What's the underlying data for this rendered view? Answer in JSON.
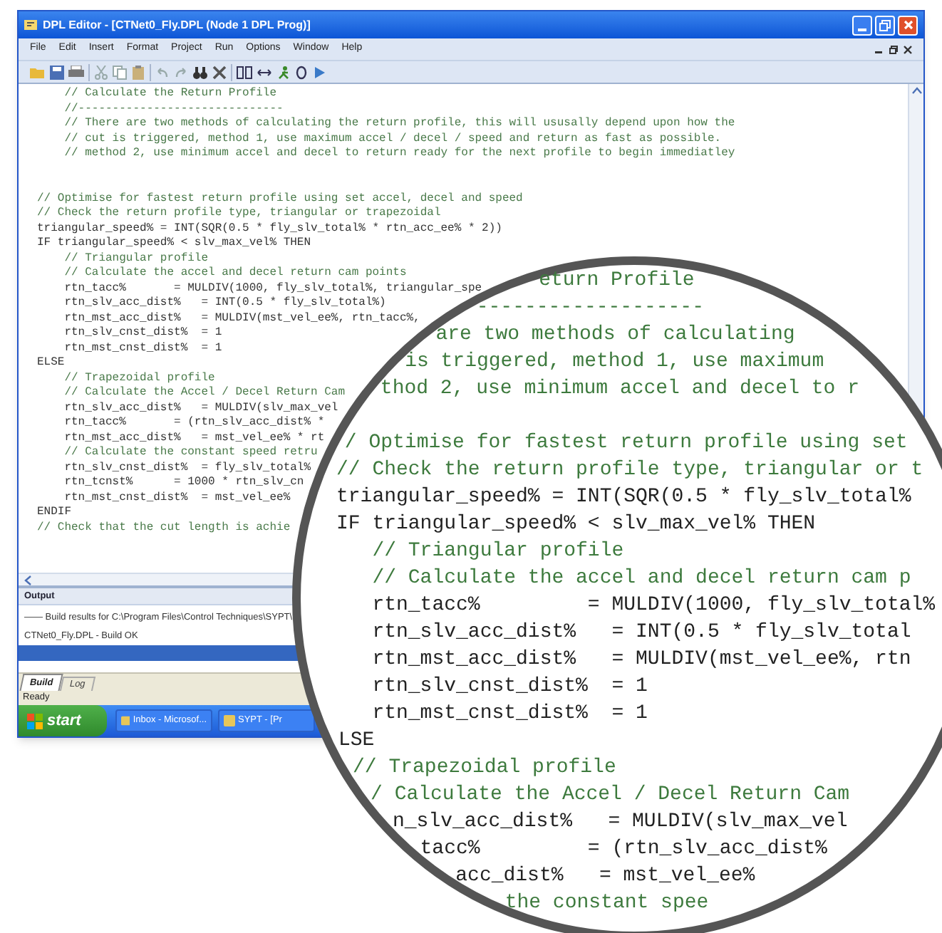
{
  "window": {
    "title": "DPL Editor - [CTNet0_Fly.DPL (Node 1 DPL Prog)]"
  },
  "menu": [
    "File",
    "Edit",
    "Insert",
    "Format",
    "Project",
    "Run",
    "Options",
    "Window",
    "Help"
  ],
  "editor": {
    "lines": [
      {
        "kind": "comment",
        "text": "    // Calculate the Return Profile"
      },
      {
        "kind": "comment",
        "text": "    //------------------------------"
      },
      {
        "kind": "comment",
        "text": "    // There are two methods of calculating the return profile, this will ususally depend upon how the"
      },
      {
        "kind": "comment",
        "text": "    // cut is triggered, method 1, use maximum accel / decel / speed and return as fast as possible."
      },
      {
        "kind": "comment",
        "text": "    // method 2, use minimum accel and decel to return ready for the next profile to begin immediatley"
      },
      {
        "kind": "blank"
      },
      {
        "kind": "blank"
      },
      {
        "kind": "comment",
        "text": "// Optimise for fastest return profile using set accel, decel and speed"
      },
      {
        "kind": "comment",
        "text": "// Check the return profile type, triangular or trapezoidal"
      },
      {
        "kind": "code",
        "text": "triangular_speed% = INT(SQR(0.5 * fly_slv_total% * rtn_acc_ee% * 2))"
      },
      {
        "kind": "code",
        "text": "IF triangular_speed% < slv_max_vel% THEN"
      },
      {
        "kind": "comment",
        "text": "    // Triangular profile"
      },
      {
        "kind": "comment",
        "text": "    // Calculate the accel and decel return cam points"
      },
      {
        "kind": "code",
        "text": "    rtn_tacc%       = MULDIV(1000, fly_slv_total%, triangular_spe"
      },
      {
        "kind": "code",
        "text": "    rtn_slv_acc_dist%   = INT(0.5 * fly_slv_total%)"
      },
      {
        "kind": "code",
        "text": "    rtn_mst_acc_dist%   = MULDIV(mst_vel_ee%, rtn_tacc%,"
      },
      {
        "kind": "code",
        "text": "    rtn_slv_cnst_dist%  = 1"
      },
      {
        "kind": "code",
        "text": "    rtn_mst_cnst_dist%  = 1"
      },
      {
        "kind": "code",
        "text": "ELSE"
      },
      {
        "kind": "comment",
        "text": "    // Trapezoidal profile"
      },
      {
        "kind": "comment",
        "text": "    // Calculate the Accel / Decel Return Cam"
      },
      {
        "kind": "code",
        "text": "    rtn_slv_acc_dist%   = MULDIV(slv_max_vel"
      },
      {
        "kind": "code",
        "text": "    rtn_tacc%       = (rtn_slv_acc_dist% *"
      },
      {
        "kind": "code",
        "text": "    rtn_mst_acc_dist%   = mst_vel_ee% * rt"
      },
      {
        "kind": "comment",
        "text": "    // Calculate the constant speed retru"
      },
      {
        "kind": "code",
        "text": "    rtn_slv_cnst_dist%  = fly_slv_total%"
      },
      {
        "kind": "code",
        "text": "    rtn_tcnst%      = 1000 * rtn_slv_cn"
      },
      {
        "kind": "code",
        "text": "    rtn_mst_cnst_dist%  = mst_vel_ee%"
      },
      {
        "kind": "code",
        "text": "ENDIF"
      },
      {
        "kind": "comment",
        "text": "// Check that the cut length is achie"
      }
    ]
  },
  "output": {
    "title": "Output",
    "lines": [
      {
        "text": "—— Build results for C:\\Program Files\\Control Techniques\\SYPT\\",
        "selected": false
      },
      {
        "text": "CTNet0_Fly.DPL - Build OK",
        "selected": false
      },
      {
        "selected": true
      }
    ]
  },
  "tabs": [
    {
      "label": "Build",
      "selected": true
    },
    {
      "label": "Log",
      "selected": false
    }
  ],
  "status_bar": "Ready",
  "taskbar": {
    "start": "start",
    "tasks": [
      "Inbox - Microsof...",
      "SYPT - [Pr"
    ]
  },
  "magnifier": {
    "lines": [
      {
        "kind": "comment",
        "text": "eturn Profile"
      },
      {
        "kind": "comment",
        "text": "-------------------"
      },
      {
        "kind": "comment",
        "text": "are two methods of calculating"
      },
      {
        "kind": "comment",
        "text": "is triggered, method 1, use maximum"
      },
      {
        "kind": "comment",
        "text": "thod 2, use minimum accel and decel to r"
      },
      {
        "kind": "blank"
      },
      {
        "kind": "comment",
        "text": "/ Optimise for fastest return profile using set"
      },
      {
        "kind": "comment",
        "text": "// Check the return profile type, triangular or t"
      },
      {
        "kind": "code",
        "text": "triangular_speed% = INT(SQR(0.5 * fly_slv_total%"
      },
      {
        "kind": "code",
        "text": "IF triangular_speed% < slv_max_vel% THEN"
      },
      {
        "kind": "comment",
        "text": "   // Triangular profile"
      },
      {
        "kind": "comment",
        "text": "   // Calculate the accel and decel return cam p"
      },
      {
        "kind": "code",
        "text": "   rtn_tacc%         = MULDIV(1000, fly_slv_total%"
      },
      {
        "kind": "code",
        "text": "   rtn_slv_acc_dist%   = INT(0.5 * fly_slv_total"
      },
      {
        "kind": "code",
        "text": "   rtn_mst_acc_dist%   = MULDIV(mst_vel_ee%, rtn"
      },
      {
        "kind": "code",
        "text": "   rtn_slv_cnst_dist%  = 1"
      },
      {
        "kind": "code",
        "text": "   rtn_mst_cnst_dist%  = 1"
      },
      {
        "kind": "code",
        "text": "LSE"
      },
      {
        "kind": "comment",
        "text": "// Trapezoidal profile"
      },
      {
        "kind": "comment",
        "text": "/ Calculate the Accel / Decel Return Cam"
      },
      {
        "kind": "code",
        "text": "n_slv_acc_dist%   = MULDIV(slv_max_vel"
      },
      {
        "kind": "code",
        "text": "tacc%         = (rtn_slv_acc_dist%"
      },
      {
        "kind": "code",
        "text": "acc_dist%   = mst_vel_ee%"
      },
      {
        "kind": "comment",
        "text": "the constant spee"
      }
    ]
  }
}
